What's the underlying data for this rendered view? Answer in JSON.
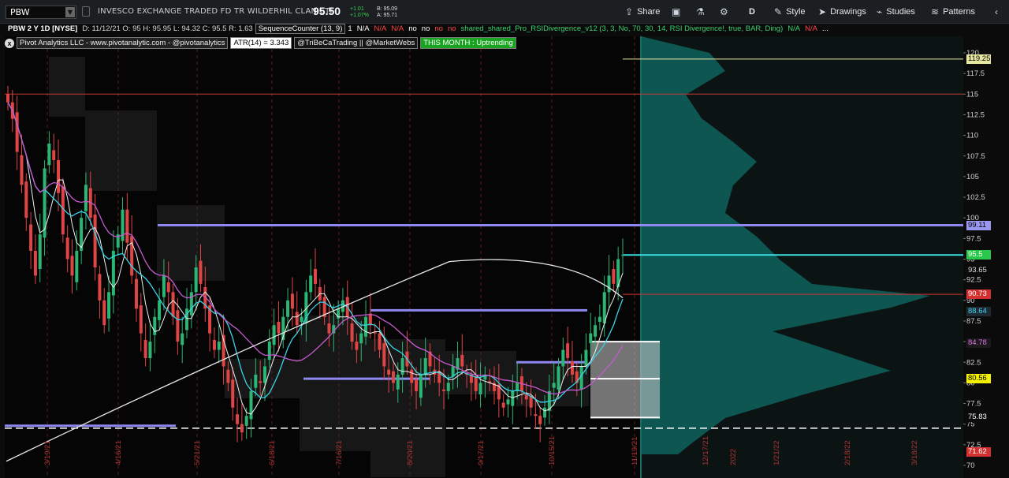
{
  "toolbar": {
    "symbol": "PBW",
    "security_name": "INVESCO EXCHANGE TRADED FD TR WILDERHIL CLAN ETF",
    "last_price": "95.50",
    "change_abs": "+1.01",
    "change_pct": "+1.07%",
    "bid": "B: 95.09",
    "ask": "A: 95.71",
    "buttons": {
      "share": "Share",
      "aggregation": "D",
      "style": "Style",
      "drawings": "Drawings",
      "studies": "Studies",
      "patterns": "Patterns"
    }
  },
  "chart_header": {
    "symbol_desc": "PBW 2 Y 1D [NYSE]",
    "ohlc": "D: 11/12/21   O: 95   H: 95.95   L: 94.32   C: 95.5   R: 1.63",
    "seq_counter": "SequenceCounter (13, 9)",
    "cells": [
      "1",
      "N/A",
      "N/A",
      "N/A",
      "no",
      "no",
      "no",
      "no"
    ],
    "rsi_study": "shared_shared_Pro_RSIDivergence_v12 (3, 3, No, 70, 30, 14, RSI Divergence!, true, BAR, Ding)",
    "rsi_vals": [
      "N/A",
      "N/A"
    ],
    "more": "..."
  },
  "labels": {
    "close": "x",
    "pivot": "Pivot Analytics LLC - www.pivotanalytic.com - @pivotanalytics",
    "atr": "ATR(14) = 3.343",
    "tribe": "@TriBeCaTrading || @MarketWebs",
    "month": "THIS MONTH : Uptrending"
  },
  "axis": {
    "ticks": [
      "120",
      "117.5",
      "115",
      "112.5",
      "110",
      "107.5",
      "105",
      "102.5",
      "100",
      "97.5",
      "95",
      "92.5",
      "90",
      "87.5",
      "85",
      "82.5",
      "80",
      "77.5",
      "75",
      "72.5",
      "70"
    ],
    "date_labels": [
      "3/19/21",
      "4/16/21",
      "5/21/21",
      "6/18/21",
      "7/16/21",
      "8/20/21",
      "9/17/21",
      "10/15/21",
      "11/19/21",
      "12/17/21",
      "2022",
      "1/21/22",
      "2/18/22",
      "3/18/22"
    ],
    "tags": [
      {
        "text": "119.25",
        "price": 119.25,
        "bg": "#e8e8a0",
        "fg": "#000"
      },
      {
        "text": "99.11",
        "price": 99.11,
        "bg": "#9a97f0",
        "fg": "#000"
      },
      {
        "text": "95.5",
        "price": 95.5,
        "bg": "#29c84b",
        "fg": "#fff"
      },
      {
        "text": "93.65",
        "price": 93.65,
        "bg": "#0b0b0b",
        "fg": "#ddd"
      },
      {
        "text": "90.73",
        "price": 90.73,
        "bg": "#d53030",
        "fg": "#fff"
      },
      {
        "text": "88.64",
        "price": 88.64,
        "bg": "#1f2a33",
        "fg": "#39d6f0"
      },
      {
        "text": "84.78",
        "price": 84.78,
        "bg": "#1a1a1a",
        "fg": "#e36ce8"
      },
      {
        "text": "80.56",
        "price": 80.56,
        "bg": "#f3f000",
        "fg": "#000"
      },
      {
        "text": "75.83",
        "price": 75.83,
        "bg": "#0b0b0b",
        "fg": "#fff"
      },
      {
        "text": "71.62",
        "price": 71.62,
        "bg": "#d53030",
        "fg": "#fff"
      }
    ]
  },
  "colors": {
    "up": "#2bb673",
    "down": "#e04545",
    "volume_profile": "#0e5a55",
    "sma_long": "#e8e8e8",
    "ema_fast": "#38d4e8",
    "ema_slow": "#c75ad0",
    "pivot_line": "#8f88f0"
  },
  "series": {
    "closes": [
      114,
      112,
      108,
      104,
      100,
      96,
      93,
      98,
      106,
      109,
      107,
      103,
      98,
      95,
      93,
      96,
      100,
      104,
      100,
      94,
      90,
      87,
      91,
      96,
      98,
      101,
      97,
      93,
      89,
      86,
      83,
      85,
      88,
      90,
      93,
      91,
      88,
      85,
      86,
      89,
      91,
      94,
      92,
      89,
      86,
      84,
      85,
      82,
      80,
      77,
      75,
      74,
      76,
      79,
      81,
      80,
      82,
      85,
      87,
      86,
      88,
      90,
      89,
      87,
      88,
      91,
      93,
      92,
      90,
      88,
      86,
      87,
      89,
      90,
      88,
      85,
      84,
      86,
      88,
      87,
      86,
      84,
      82,
      81,
      80,
      81,
      83,
      82,
      80,
      79,
      81,
      83,
      82,
      81,
      80,
      79,
      80,
      82,
      83,
      82,
      81,
      80,
      79,
      80,
      81,
      80,
      79,
      78,
      77,
      78,
      79,
      80,
      79,
      78,
      77,
      76,
      75,
      77,
      79,
      80,
      82,
      84,
      83,
      81,
      80,
      82,
      84,
      86,
      87,
      88,
      91,
      93,
      92,
      95,
      95.5
    ]
  }
}
